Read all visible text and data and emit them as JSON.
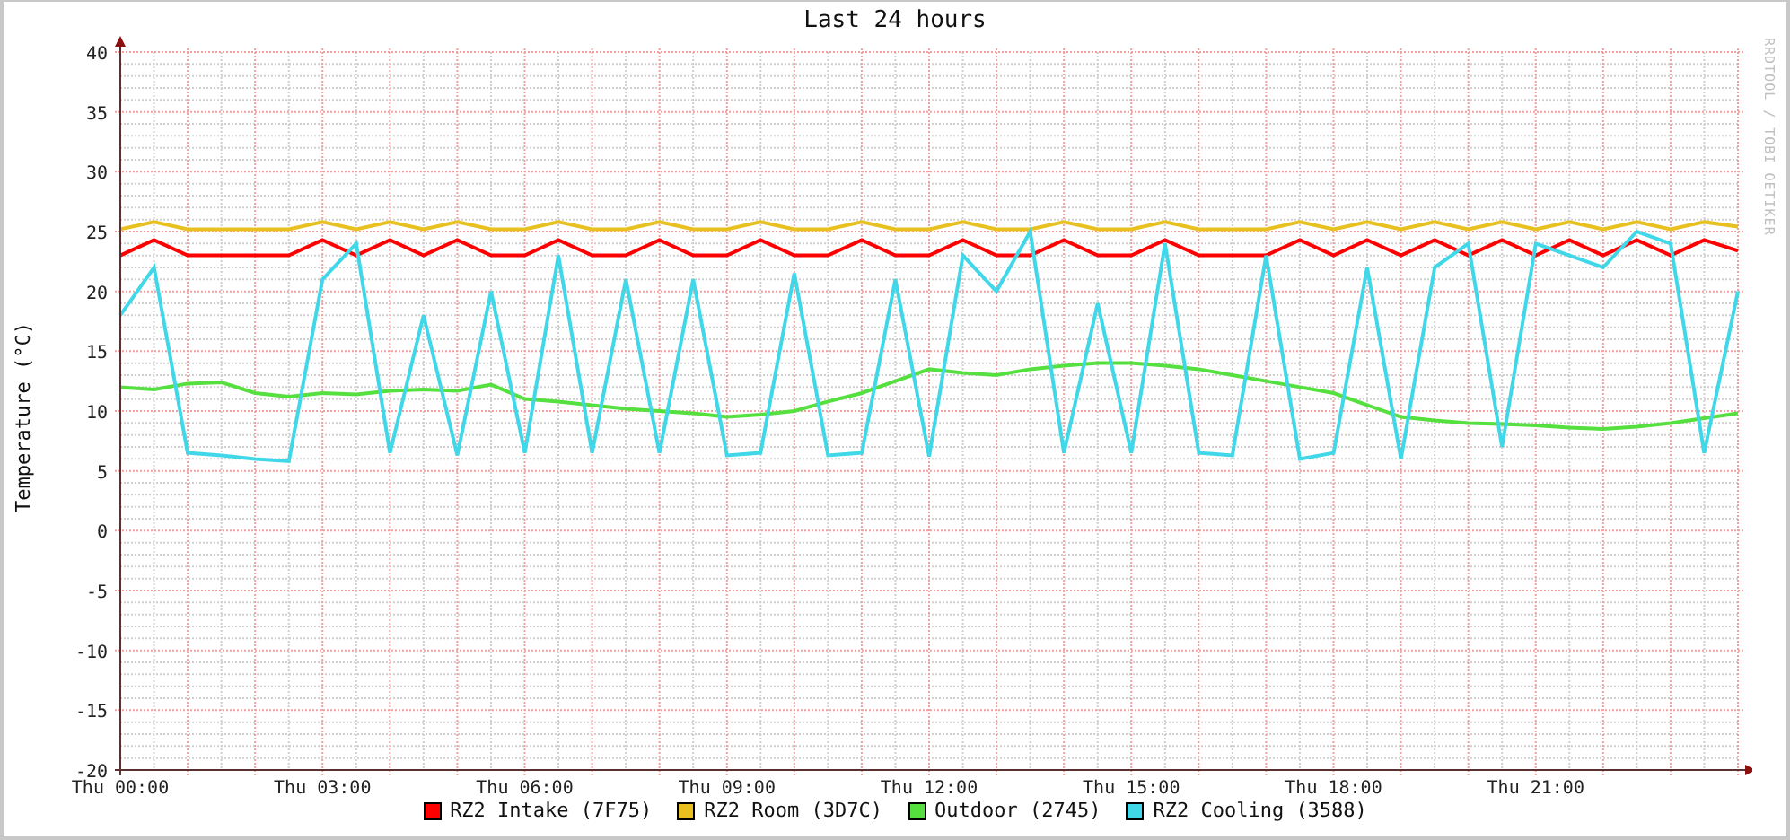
{
  "graph": {
    "credit": "RRDTOOL / TOBI OETIKER",
    "chart_data": {
      "type": "line",
      "title": "Last 24 hours",
      "ylabel": "Temperature (°C)",
      "categories": [
        "Thu 00:00",
        null,
        null,
        null,
        null,
        null,
        "Thu 03:00",
        null,
        null,
        null,
        null,
        null,
        "Thu 06:00",
        null,
        null,
        null,
        null,
        null,
        "Thu 09:00",
        null,
        null,
        null,
        null,
        null,
        "Thu 12:00",
        null,
        null,
        null,
        null,
        null,
        "Thu 15:00",
        null,
        null,
        null,
        null,
        null,
        "Thu 18:00",
        null,
        null,
        null,
        null,
        null,
        "Thu 21:00",
        null,
        null,
        null,
        null,
        null,
        null
      ],
      "grid": true,
      "ylim": [
        -20,
        40
      ],
      "yticks": [
        -20,
        -15,
        -10,
        -5,
        0,
        5,
        10,
        15,
        20,
        25,
        30,
        35,
        40
      ],
      "series": [
        {
          "name": "RZ2 Intake (7F75)",
          "color": "#ff0000",
          "values": [
            23,
            24.3,
            23,
            23,
            23,
            23,
            24.3,
            23,
            24.3,
            23,
            24.3,
            23,
            23,
            24.3,
            23,
            23,
            24.3,
            23,
            23,
            24.3,
            23,
            23,
            24.3,
            23,
            23,
            24.3,
            23,
            23,
            24.3,
            23,
            23,
            24.3,
            23,
            23,
            23,
            24.3,
            23,
            24.3,
            23,
            24.3,
            23,
            24.3,
            23,
            24.3,
            23,
            24.3,
            23,
            24.3,
            23.4
          ]
        },
        {
          "name": "RZ2 Room (3D7C)",
          "color": "#e8c020",
          "values": [
            25.2,
            25.8,
            25.2,
            25.2,
            25.2,
            25.2,
            25.8,
            25.2,
            25.8,
            25.2,
            25.8,
            25.2,
            25.2,
            25.8,
            25.2,
            25.2,
            25.8,
            25.2,
            25.2,
            25.8,
            25.2,
            25.2,
            25.8,
            25.2,
            25.2,
            25.8,
            25.2,
            25.2,
            25.8,
            25.2,
            25.2,
            25.8,
            25.2,
            25.2,
            25.2,
            25.8,
            25.2,
            25.8,
            25.2,
            25.8,
            25.2,
            25.8,
            25.2,
            25.8,
            25.2,
            25.8,
            25.2,
            25.8,
            25.4
          ]
        },
        {
          "name": "Outdoor (2745)",
          "color": "#55e040",
          "values": [
            12,
            11.8,
            12.3,
            12.4,
            11.5,
            11.2,
            11.5,
            11.4,
            11.7,
            11.8,
            11.7,
            12.2,
            11,
            10.8,
            10.5,
            10.2,
            10,
            9.8,
            9.5,
            9.7,
            10,
            10.8,
            11.5,
            12.5,
            13.5,
            13.2,
            13,
            13.5,
            13.8,
            14,
            14,
            13.8,
            13.5,
            13,
            12.5,
            12,
            11.5,
            10.5,
            9.5,
            9.2,
            9,
            8.9,
            8.8,
            8.6,
            8.5,
            8.7,
            9,
            9.4,
            9.8
          ]
        },
        {
          "name": "RZ2 Cooling (3588)",
          "color": "#40d8e8",
          "values": [
            18,
            22,
            6.5,
            6.3,
            6,
            5.8,
            21,
            24,
            6.5,
            18,
            6.3,
            20,
            6.5,
            23,
            6.5,
            21,
            6.5,
            21,
            6.3,
            6.5,
            21.5,
            6.3,
            6.5,
            21,
            6.2,
            23,
            20,
            25,
            6.5,
            19,
            6.5,
            24,
            6.5,
            6.3,
            23,
            6,
            6.5,
            22,
            6,
            22,
            24,
            7,
            24,
            23,
            22,
            25,
            24,
            6.5,
            20
          ]
        }
      ]
    }
  }
}
